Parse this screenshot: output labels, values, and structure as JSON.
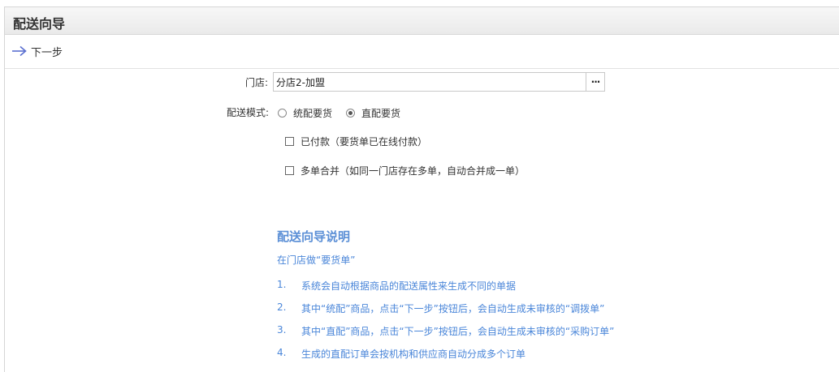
{
  "window": {
    "title": "配送向导"
  },
  "toolbar": {
    "next_label": "下一步"
  },
  "form": {
    "store_label": "门店:",
    "store_value": "分店2-加盟",
    "more_button": "···",
    "mode_label": "配送模式:",
    "mode_options": [
      {
        "label": "统配要货",
        "selected": false
      },
      {
        "label": "直配要货",
        "selected": true
      }
    ],
    "paid_label": "已付款（要货单已在线付款）",
    "paid_checked": false,
    "merge_label": "多单合并（如同一门店存在多单，自动合并成一单）",
    "merge_checked": false
  },
  "help": {
    "title": "配送向导说明",
    "intro": "在门店做“要货单”",
    "items": [
      {
        "num": "1.",
        "text": "系统会自动根据商品的配送属性来生成不同的单据"
      },
      {
        "num": "2.",
        "text": "其中“统配”商品，点击“下一步”按钮后，会自动生成未审核的“调拨单”"
      },
      {
        "num": "3.",
        "text": "其中“直配”商品，点击“下一步”按钮后，会自动生成未审核的“采购订单”"
      },
      {
        "num": "4.",
        "text": "生成的直配订单会按机构和供应商自动分成多个订单"
      }
    ]
  },
  "colors": {
    "accent": "#4a86d9",
    "arrow": "#5a6fd0"
  },
  "icons": {
    "next": "arrow-right-icon",
    "more": "ellipsis-icon"
  }
}
